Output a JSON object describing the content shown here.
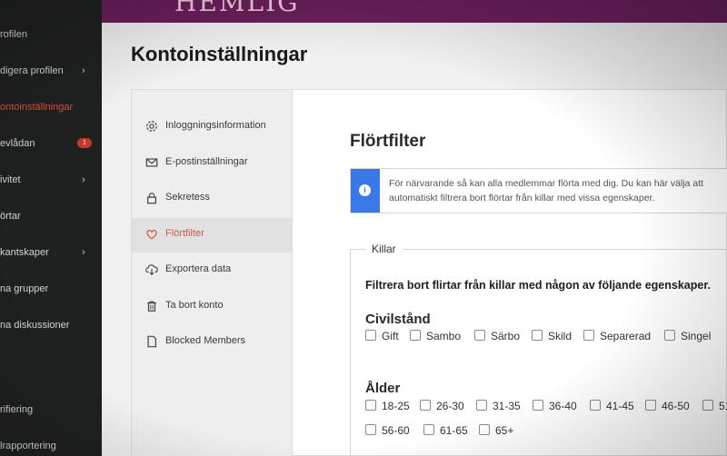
{
  "left_nav": {
    "items": [
      {
        "label": "rofilen",
        "chevron": "",
        "badge": "",
        "active": false
      },
      {
        "label": "digera profilen",
        "chevron": "›",
        "badge": "",
        "active": false
      },
      {
        "label": "ontoinställningar",
        "chevron": "",
        "badge": "",
        "active": true
      },
      {
        "label": "evlådan",
        "chevron": "",
        "badge": "1",
        "active": false
      },
      {
        "label": "ivitet",
        "chevron": "›",
        "badge": "",
        "active": false
      },
      {
        "label": "örtar",
        "chevron": "",
        "badge": "",
        "active": false
      },
      {
        "label": "kantskaper",
        "chevron": "›",
        "badge": "",
        "active": false
      },
      {
        "label": "na grupper",
        "chevron": "",
        "badge": "",
        "active": false
      },
      {
        "label": "na diskussioner",
        "chevron": "",
        "badge": "",
        "active": false
      },
      {
        "label": "rifiering",
        "chevron": "",
        "badge": "",
        "active": false
      },
      {
        "label": "lrapportering",
        "chevron": "",
        "badge": "",
        "active": false
      }
    ]
  },
  "banner": {
    "logo_text": "HEMLIG",
    "color": "#6b1f5c"
  },
  "page": {
    "title": "Kontoinställningar"
  },
  "sub_nav": {
    "items": [
      {
        "label": "Inloggningsinformation",
        "icon": "gear-icon",
        "active": false
      },
      {
        "label": "E-postinställningar",
        "icon": "envelope-icon",
        "active": false
      },
      {
        "label": "Sekretess",
        "icon": "lock-icon",
        "active": false
      },
      {
        "label": "Flörtfilter",
        "icon": "heart-icon",
        "active": true
      },
      {
        "label": "Exportera data",
        "icon": "cloud-download-icon",
        "active": false
      },
      {
        "label": "Ta bort konto",
        "icon": "trash-icon",
        "active": false
      },
      {
        "label": "Blocked Members",
        "icon": "document-icon",
        "active": false
      }
    ]
  },
  "content": {
    "section_title": "Flörtfilter",
    "info_line1": "För närvarande så kan alla medlemmar flörta med dig. Du kan här välja att",
    "info_line2": "automatiskt filtrera bort flörtar från killar med vissa egenskaper.",
    "fieldset_legend": "Killar",
    "filter_heading": "Filtrera bort flirtar från killar med någon av följande egenskaper.",
    "civil": {
      "title": "Civilstånd",
      "options": [
        "Gift",
        "Sambo",
        "Särbo",
        "Skild",
        "Separerad",
        "Singel"
      ]
    },
    "age": {
      "title": "Ålder",
      "options_row1": [
        "18-25",
        "26-30",
        "31-35",
        "36-40",
        "41-45",
        "46-50",
        "51"
      ],
      "options_row2": [
        "56-60",
        "61-65",
        "65+"
      ]
    }
  },
  "colors": {
    "accent_red": "#d9534f",
    "info_blue": "#3a78e8"
  }
}
